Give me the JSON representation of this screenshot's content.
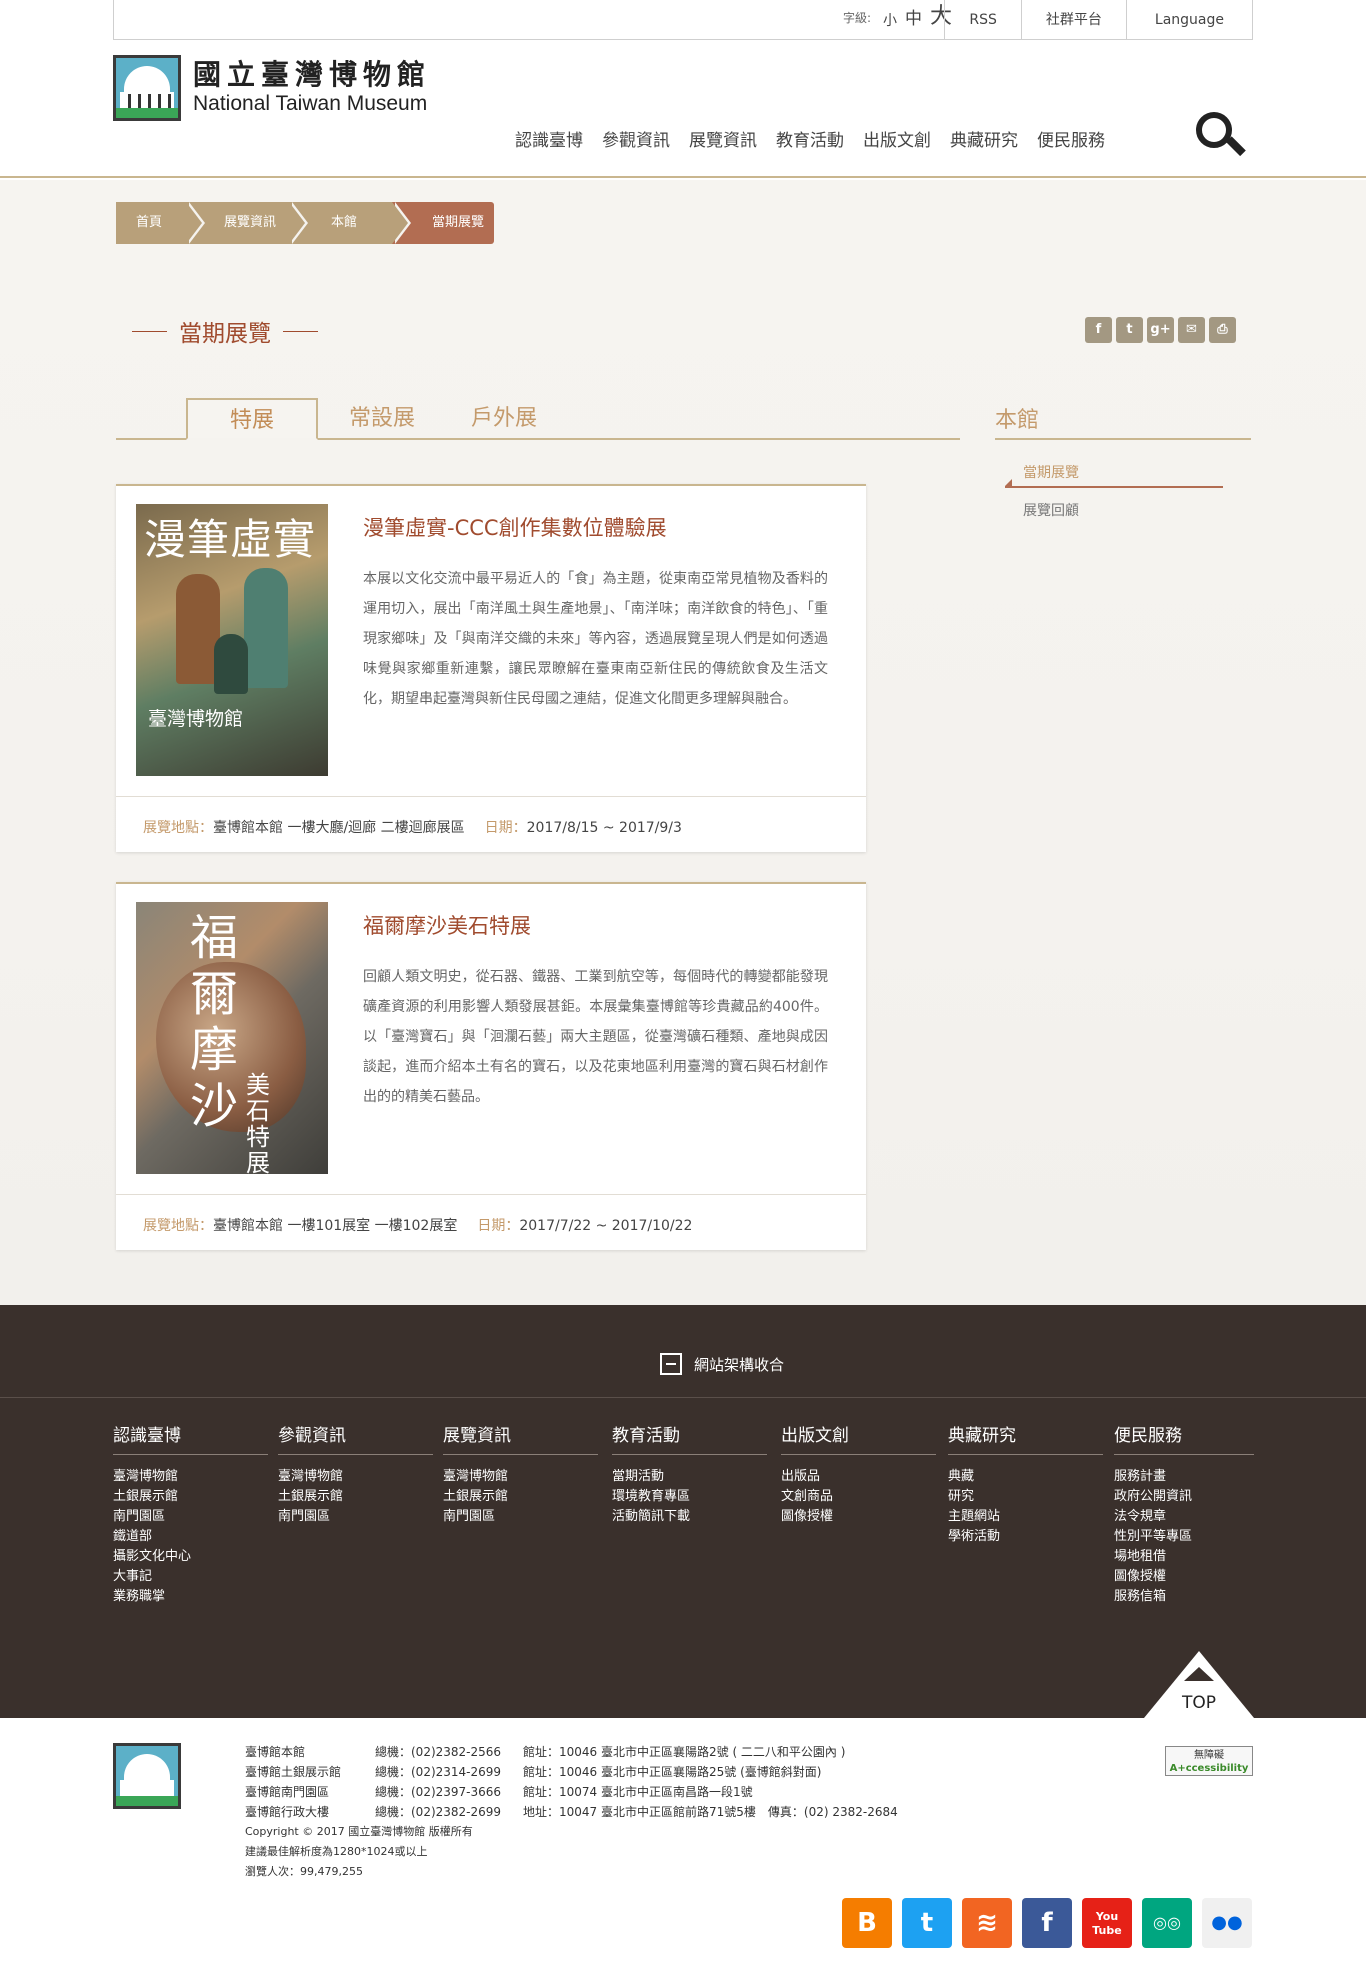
{
  "topbar": {
    "font_label": "字級:",
    "font_small": "小",
    "font_medium": "中",
    "font_large": "大",
    "links": [
      "RSS",
      "社群平台",
      "Language"
    ]
  },
  "header": {
    "logo_zh": "國立臺灣博物館",
    "logo_en": "National Taiwan Museum",
    "nav": [
      "認識臺博",
      "參觀資訊",
      "展覽資訊",
      "教育活動",
      "出版文創",
      "典藏研究",
      "便民服務"
    ],
    "search_icon": "search-icon"
  },
  "breadcrumb": [
    "首頁",
    "展覽資訊",
    "本館",
    "當期展覽"
  ],
  "page_title": "當期展覽",
  "share": [
    "f",
    "t",
    "g+",
    "✉",
    "⎙"
  ],
  "tabs": [
    "特展",
    "常設展",
    "戶外展"
  ],
  "sidebar": {
    "title": "本館",
    "items": [
      "當期展覽",
      "展覽回顧"
    ]
  },
  "exhibitions": [
    {
      "title": "漫筆虛實-CCC創作集數位體驗展",
      "desc": "本展以文化交流中最平易近人的「食」為主題，從東南亞常見植物及香料的運用切入，展出「南洋風土與生產地景」、「南洋味；南洋飲食的特色」、「重現家鄉味」及「與南洋交織的未來」等內容，透過展覽呈現人們是如何透過味覺與家鄉重新連繫，讓民眾瞭解在臺東南亞新住民的傳統飲食及生活文化，期望串起臺灣與新住民母國之連結，促進文化間更多理解與融合。",
      "location_label": "展覽地點：",
      "location": "臺博館本館 一樓大廳/迴廊 二樓迴廊展區",
      "date_label": "日期：",
      "date": "2017/8/15 ~ 2017/9/3",
      "poster_title": "漫筆虛實",
      "poster_sub": "臺灣博物館"
    },
    {
      "title": "福爾摩沙美石特展",
      "desc": "回顧人類文明史，從石器、鐵器、工業到航空等，每個時代的轉變都能發現礦產資源的利用影響人類發展甚鉅。本展彙集臺博館等珍貴藏品約400件。以「臺灣寶石」與「洄瀾石藝」兩大主題區，從臺灣礦石種類、產地與成因談起，進而介紹本土有名的寶石，以及花東地區利用臺灣的寶石與石材創作出的的精美石藝品。",
      "location_label": "展覽地點：",
      "location": "臺博館本館 一樓101展室 一樓102展室",
      "date_label": "日期：",
      "date": "2017/7/22 ~ 2017/10/22",
      "poster_title": "福爾摩沙",
      "poster_sub": "美石特展"
    }
  ],
  "footer": {
    "collapse_label": "網站架構收合",
    "columns": [
      {
        "title": "認識臺博",
        "items": [
          "臺灣博物館",
          "土銀展示館",
          "南門園區",
          "鐵道部",
          "攝影文化中心",
          "大事記",
          "業務職掌"
        ]
      },
      {
        "title": "參觀資訊",
        "items": [
          "臺灣博物館",
          "土銀展示館",
          "南門園區"
        ]
      },
      {
        "title": "展覽資訊",
        "items": [
          "臺灣博物館",
          "土銀展示館",
          "南門園區"
        ]
      },
      {
        "title": "教育活動",
        "items": [
          "當期活動",
          "環境教育專區",
          "活動簡訊下載"
        ]
      },
      {
        "title": "出版文創",
        "items": [
          "出版品",
          "文創商品",
          "圖像授權"
        ]
      },
      {
        "title": "典藏研究",
        "items": [
          "典藏",
          "研究",
          "主題網站",
          "學術活動"
        ]
      },
      {
        "title": "便民服務",
        "items": [
          "服務計畫",
          "政府公開資訊",
          "法令規章",
          "性別平等專區",
          "場地租借",
          "圖像授權",
          "服務信箱"
        ]
      }
    ],
    "top_label": "TOP",
    "addresses": [
      {
        "name": "臺博館本館",
        "tel": "總機：(02)2382-2566",
        "addr": "館址：10046 臺北市中正區襄陽路2號 ( 二二八和平公園內 )"
      },
      {
        "name": "臺博館土銀展示館",
        "tel": "總機：(02)2314-2699",
        "addr": "館址：10046 臺北市中正區襄陽路25號 (臺博館斜對面)"
      },
      {
        "name": "臺博館南門園區",
        "tel": "總機：(02)2397-3666",
        "addr": "館址：10074 臺北市中正區南昌路一段1號"
      },
      {
        "name": "臺博館行政大樓",
        "tel": "總機：(02)2382-2699",
        "addr": "地址：10047 臺北市中正區館前路71號5樓　傳真：(02) 2382-2684"
      }
    ],
    "copyright": "Copyright © 2017  國立臺灣博物館 版權所有",
    "resolution": "建議最佳解析度為1280*1024或以上",
    "visitors": "瀏覽人次：99,479,255",
    "badge_top": "無障礙",
    "badge_bottom": "A+ccessibility",
    "socials": [
      {
        "name": "blogger-icon",
        "glyph": "B",
        "color": "#f57d00"
      },
      {
        "name": "twitter-icon",
        "glyph": "t",
        "color": "#1da1f2"
      },
      {
        "name": "rss-icon",
        "glyph": "≋",
        "color": "#f26522"
      },
      {
        "name": "facebook-icon",
        "glyph": "f",
        "color": "#3b5998"
      },
      {
        "name": "youtube-icon",
        "glyph": "You Tube",
        "color": "#e62117"
      },
      {
        "name": "tripadvisor-icon",
        "glyph": "◎◎",
        "color": "#00a680"
      },
      {
        "name": "flickr-icon",
        "glyph": "●●",
        "color": "#f0f0f0"
      }
    ]
  }
}
